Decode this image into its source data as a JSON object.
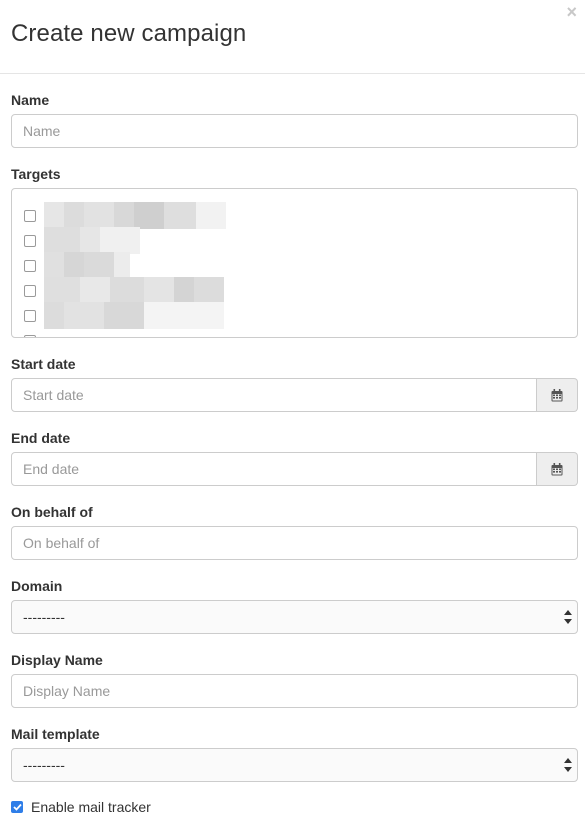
{
  "modal": {
    "title": "Create new campaign",
    "close_glyph": "×"
  },
  "form": {
    "name": {
      "label": "Name",
      "placeholder": "Name"
    },
    "targets": {
      "label": "Targets",
      "visible_checkbox_count": 6,
      "checked": false
    },
    "start_date": {
      "label": "Start date",
      "placeholder": "Start date",
      "icon": "calendar-icon"
    },
    "end_date": {
      "label": "End date",
      "placeholder": "End date",
      "icon": "calendar-icon"
    },
    "on_behalf_of": {
      "label": "On behalf of",
      "placeholder": "On behalf of"
    },
    "domain": {
      "label": "Domain",
      "selected": "---------"
    },
    "display_name": {
      "label": "Display Name",
      "placeholder": "Display Name"
    },
    "mail_template": {
      "label": "Mail template",
      "selected": "---------"
    },
    "enable_mail_tracker": {
      "label": "Enable mail tracker",
      "checked": true
    }
  },
  "colors": {
    "accent": "#2f7ee8",
    "border": "#cccccc",
    "addon_bg": "#eeeeee",
    "placeholder": "#999999"
  }
}
